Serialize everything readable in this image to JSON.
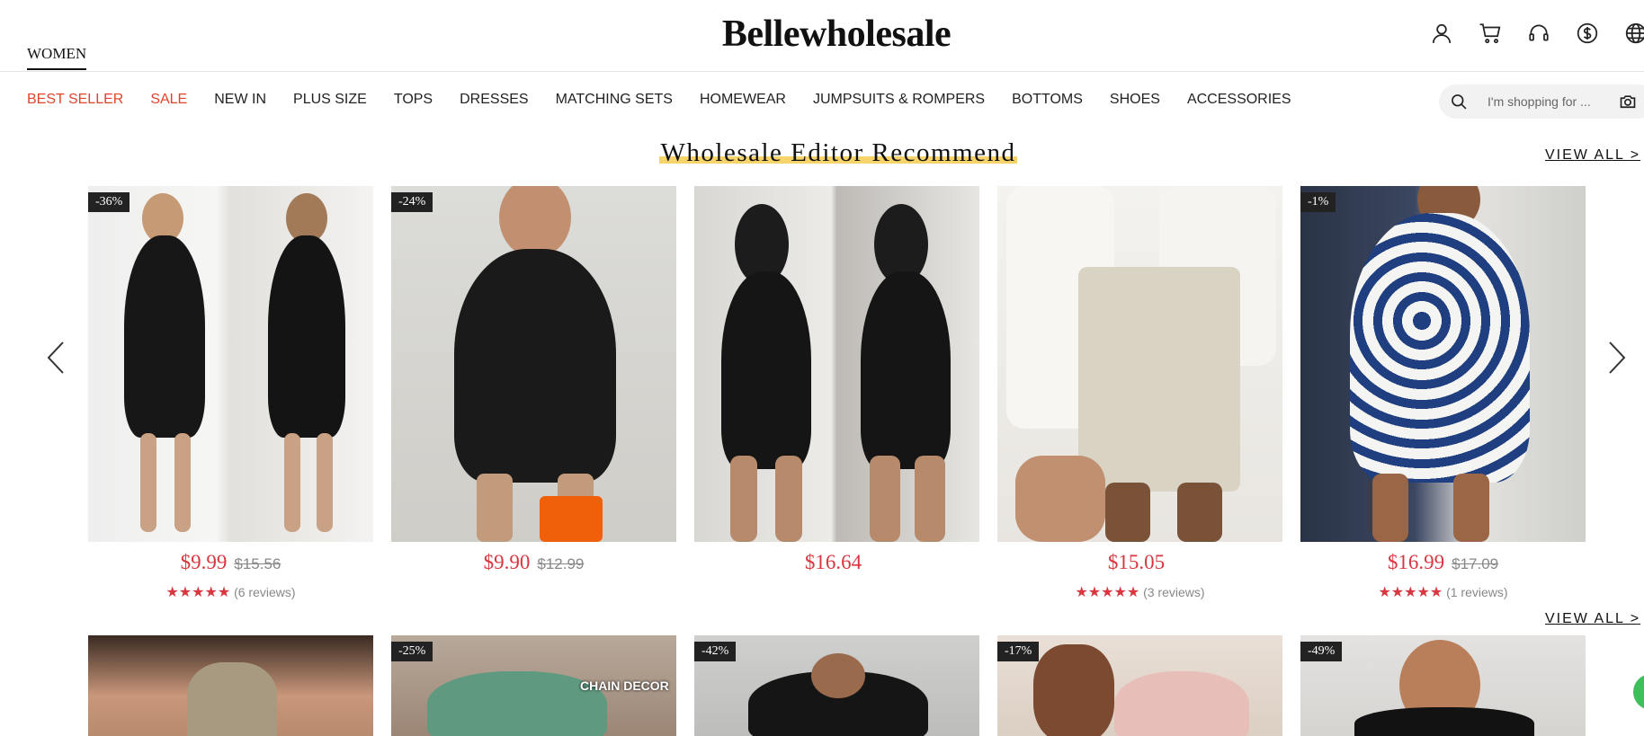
{
  "header": {
    "women_tab": "WOMEN",
    "logo": "Bellewholesale",
    "icons": [
      "account-icon",
      "cart-icon",
      "support-icon",
      "currency-icon",
      "language-icon"
    ]
  },
  "nav": {
    "items": [
      "BEST SELLER",
      "SALE",
      "NEW IN",
      "PLUS SIZE",
      "TOPS",
      "DRESSES",
      "MATCHING SETS",
      "HOMEWEAR",
      "JUMPSUITS & ROMPERS",
      "BOTTOMS",
      "SHOES",
      "ACCESSORIES"
    ],
    "highlight_color": "#e0452b"
  },
  "search": {
    "placeholder": "I'm shopping for ..."
  },
  "section": {
    "title": "Wholesale Editor Recommend",
    "view_all": "VIEW ALL >",
    "view_all_2": "VIEW ALL >"
  },
  "products": [
    {
      "badge": "-36%",
      "price": "$9.99",
      "old_price": "$15.56",
      "stars": "★★★★★",
      "reviews": "(6 reviews)"
    },
    {
      "badge": "-24%",
      "price": "$9.90",
      "old_price": "$12.99",
      "stars": "",
      "reviews": ""
    },
    {
      "badge": "",
      "price": "$16.64",
      "old_price": "",
      "stars": "",
      "reviews": ""
    },
    {
      "badge": "",
      "price": "$15.05",
      "old_price": "",
      "stars": "★★★★★",
      "reviews": "(3 reviews)"
    },
    {
      "badge": "-1%",
      "price": "$16.99",
      "old_price": "$17.09",
      "stars": "★★★★★",
      "reviews": "(1 reviews)"
    }
  ],
  "row2": [
    {
      "badge": ""
    },
    {
      "badge": "-25%",
      "overlay": "CHAIN DECOR"
    },
    {
      "badge": "-42%"
    },
    {
      "badge": "-17%"
    },
    {
      "badge": "-49%"
    }
  ],
  "colors": {
    "price": "#d8373f",
    "highlight": "#f7d46a"
  }
}
